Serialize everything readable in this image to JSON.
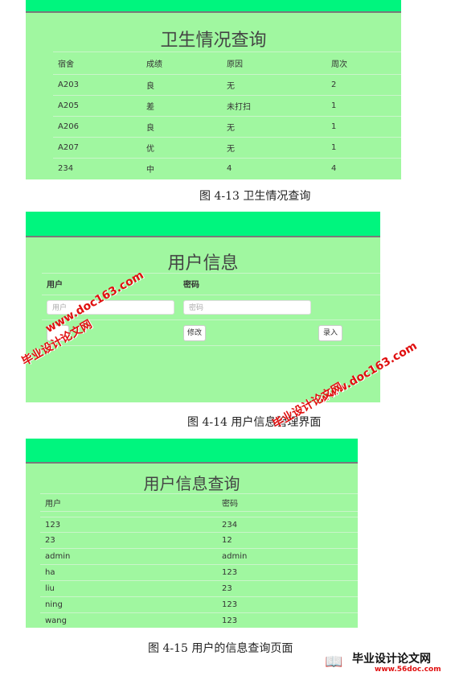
{
  "fig13": {
    "title": "卫生情况查询",
    "headers": [
      "宿舍",
      "成绩",
      "原因",
      "周次"
    ],
    "rows": [
      [
        "A203",
        "良",
        "无",
        "2"
      ],
      [
        "A205",
        "差",
        "未打扫",
        "1"
      ],
      [
        "A206",
        "良",
        "无",
        "1"
      ],
      [
        "A207",
        "优",
        "无",
        "1"
      ],
      [
        "234",
        "中",
        "4",
        "4"
      ]
    ],
    "caption": "图 4-13 卫生情况查询"
  },
  "fig14": {
    "title": "用户信息",
    "col_user": "用户",
    "col_password": "密码",
    "user_placeholder": "用户",
    "password_placeholder": "密码",
    "button_modify": "修改",
    "button_enter": "录入",
    "caption": "图 4-14 用户信息管理界面"
  },
  "fig15": {
    "title": "用户信息查询",
    "headers": [
      "用户",
      "密码"
    ],
    "rows": [
      [
        "123",
        "234"
      ],
      [
        "23",
        "12"
      ],
      [
        "admin",
        "admin"
      ],
      [
        "ha",
        "123"
      ],
      [
        "liu",
        "23"
      ],
      [
        "ning",
        "123"
      ],
      [
        "wang",
        "123"
      ]
    ],
    "caption": "图 4-15 用户的信息查询页面"
  },
  "watermarks": {
    "site": "www.doc163.com",
    "brand": "毕业设计论文网",
    "footer_brand": "毕业设计论文网",
    "footer_url": "www.56doc.com"
  },
  "colors": {
    "panel": "#a0f7a0",
    "header_bar": "#00f57e",
    "watermark": "#e01010"
  }
}
